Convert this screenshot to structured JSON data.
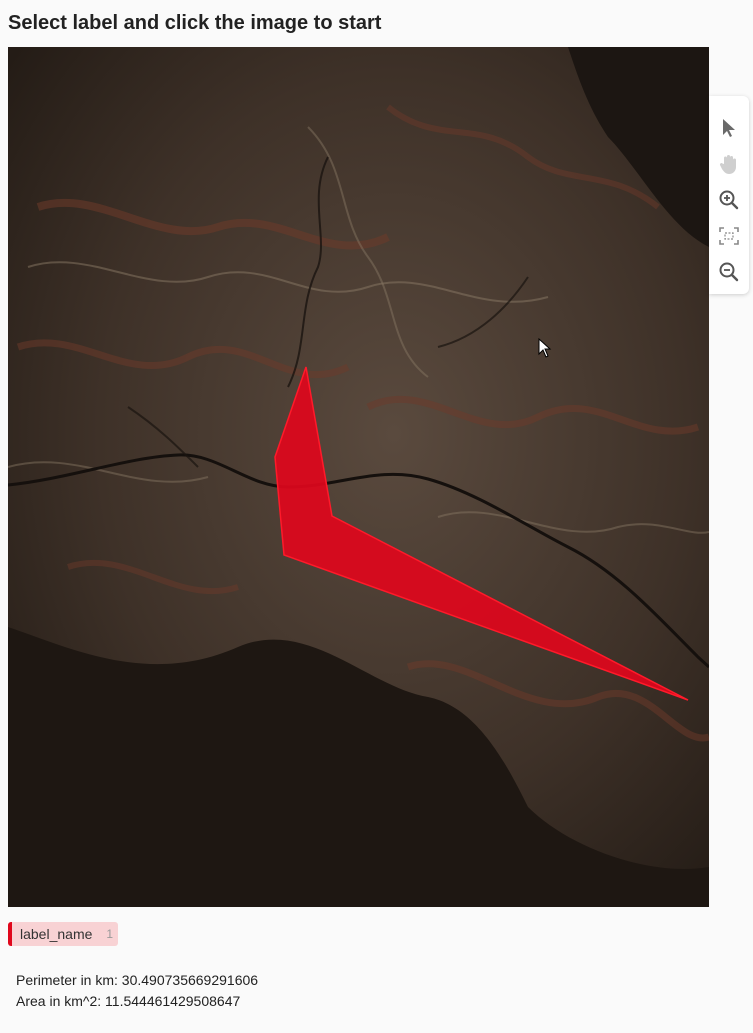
{
  "header": {
    "title": "Select label and click the image to start"
  },
  "toolbar": {
    "tools": [
      {
        "icon": "pointer-icon",
        "name": "select-tool"
      },
      {
        "icon": "hand-icon",
        "name": "pan-tool"
      },
      {
        "icon": "zoom-in-icon",
        "name": "zoom-in-tool"
      },
      {
        "icon": "fit-screen-icon",
        "name": "fit-tool"
      },
      {
        "icon": "zoom-out-icon",
        "name": "zoom-out-tool"
      }
    ]
  },
  "annotation": {
    "color": "#e0071c"
  },
  "labels": [
    {
      "name": "label_name",
      "count": "1",
      "color": "#e0071c"
    }
  ],
  "stats": {
    "perimeter": "Perimeter in km: 30.490735669291606",
    "area": "Area in km^2: 11.544461429508647"
  }
}
